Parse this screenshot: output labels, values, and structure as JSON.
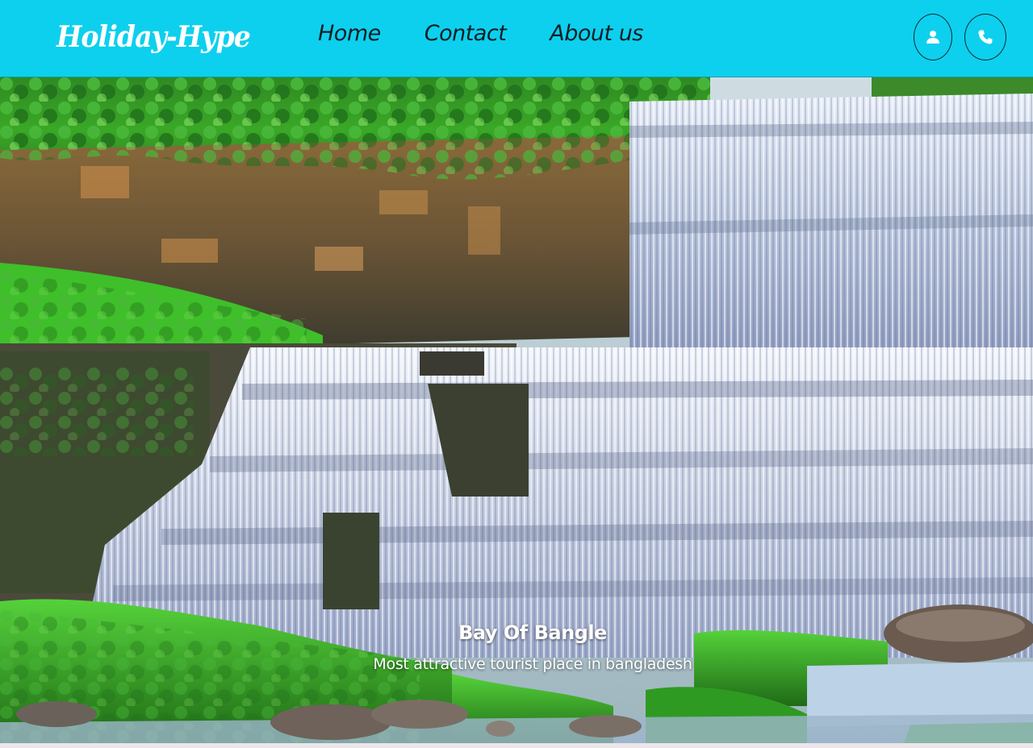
{
  "brand": {
    "name": "Holiday-Hype"
  },
  "nav": {
    "links": [
      {
        "label": "Home"
      },
      {
        "label": "Contact"
      },
      {
        "label": "About us"
      }
    ],
    "user_icon": "user-icon",
    "phone_icon": "phone-icon"
  },
  "hero": {
    "image": "waterfall-landscape",
    "title": "Bay Of Bangle",
    "subtitle": "Most attractive tourist place in bangladesh"
  },
  "colors": {
    "navbar_bg": "#0dd0ee",
    "nav_text": "#0a1e24",
    "brand_text": "#ffffff",
    "caption_text": "#ffffff"
  }
}
